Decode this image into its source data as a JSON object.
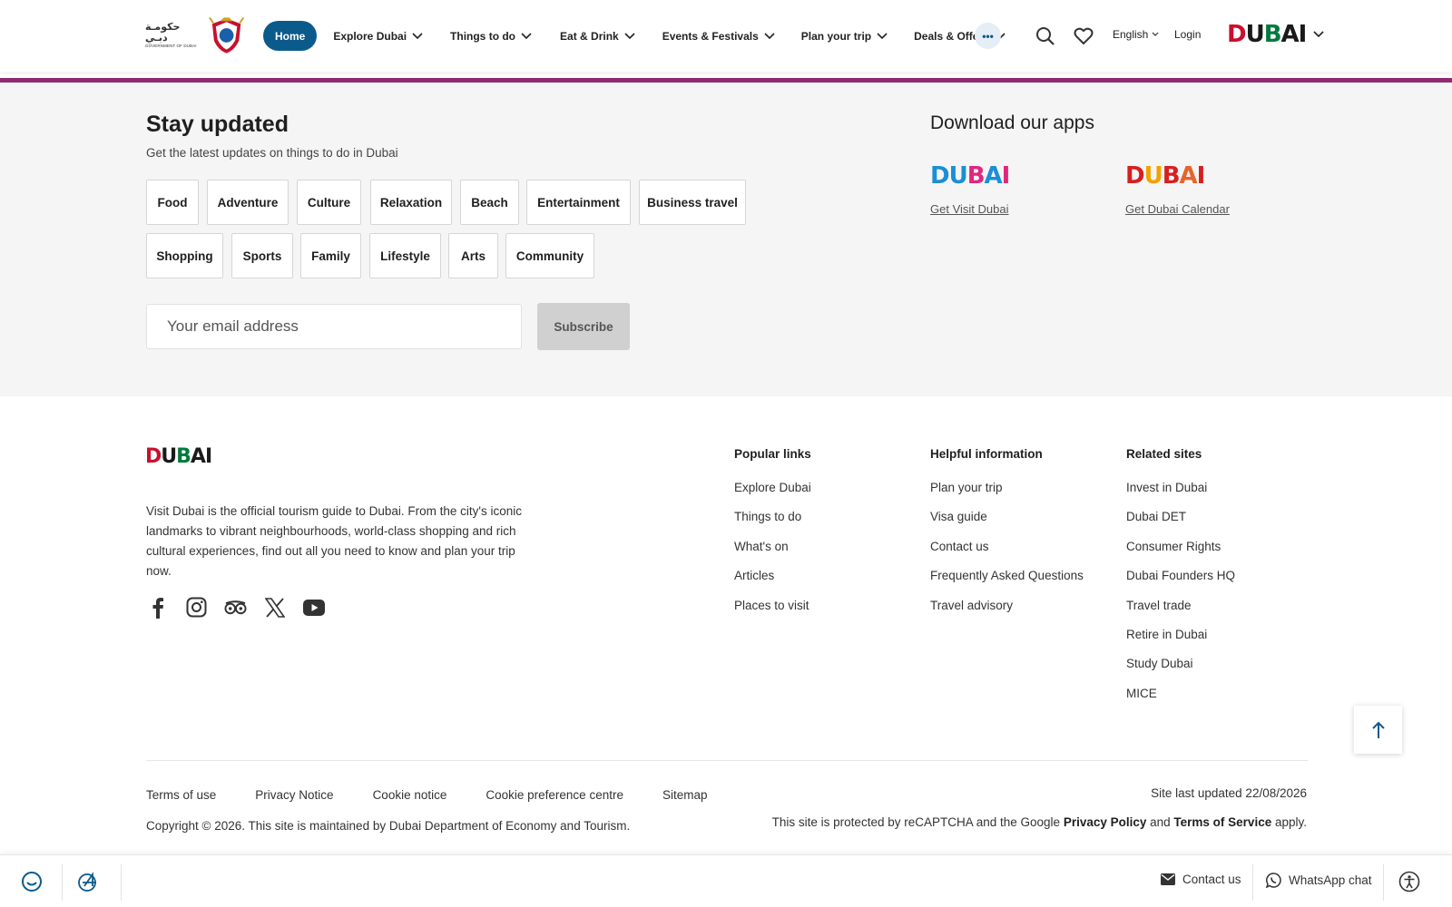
{
  "header": {
    "gov_logo_ar": "حكومـة دبـي",
    "gov_logo_en": "GOVERNMENT OF DUBAI",
    "home_label": "Home",
    "nav": [
      "Explore Dubai",
      "Things to do",
      "Eat & Drink",
      "Events & Festivals",
      "Plan your trip",
      "Deals & Offers"
    ],
    "more_label": "•••",
    "language": "English",
    "login": "Login",
    "brand_logo_text": "DUBAI"
  },
  "newsletter": {
    "title": "Stay updated",
    "subtitle": "Get the latest updates on things to do in Dubai",
    "interests_row1": [
      "Food",
      "Adventure",
      "Culture",
      "Relaxation",
      "Beach",
      "Entertainment",
      "Business travel"
    ],
    "interests_row2": [
      "Shopping",
      "Sports",
      "Family",
      "Lifestyle",
      "Arts",
      "Community"
    ],
    "email_placeholder": "Your email address",
    "subscribe_label": "Subscribe"
  },
  "apps": {
    "title": "Download our apps",
    "visit_dubai_link": "Get Visit Dubai",
    "calendar_link": "Get Dubai Calendar"
  },
  "footer": {
    "description": "Visit Dubai is the official tourism guide to Dubai. From the city's iconic landmarks to vibrant neighbourhoods, world-class shopping and rich cultural experiences, find out all you need to know and plan your trip now.",
    "popular_links": {
      "title": "Popular links",
      "items": [
        "Explore Dubai",
        "Things to do",
        "What's on",
        "Articles",
        "Places to visit"
      ]
    },
    "helpful_information": {
      "title": "Helpful information",
      "items": [
        "Plan your trip",
        "Visa guide",
        "Contact us",
        "Frequently Asked Questions",
        "Travel advisory"
      ]
    },
    "related_sites": {
      "title": "Related sites",
      "items": [
        "Invest in Dubai",
        "Dubai DET",
        "Consumer Rights",
        "Dubai Founders HQ",
        "Travel trade",
        "Retire in Dubai",
        "Study Dubai",
        "MICE"
      ]
    },
    "legal_links": [
      "Terms of use",
      "Privacy Notice",
      "Cookie notice",
      "Cookie preference centre",
      "Sitemap"
    ],
    "copyright": "Copyright © 2026. This site is maintained by Dubai Department of Economy and Tourism.",
    "site_updated": "Site last updated 22/08/2026",
    "recaptcha_prefix": "This site is protected by reCAPTCHA and the Google ",
    "privacy_policy": "Privacy Policy",
    "recaptcha_and": " and ",
    "terms_of_service": "Terms of Service",
    "recaptcha_suffix": " apply."
  },
  "bottom_bar": {
    "contact_us": "Contact us",
    "whatsapp": "WhatsApp chat"
  },
  "colors": {
    "primary_blue": "#0b5a8c",
    "purple_band": "#8e2a72",
    "newsletter_bg": "#f5f5f5",
    "subscribe_bg": "#d0d0d0"
  },
  "icons": {
    "header": [
      "chevron-down-icon",
      "search-icon",
      "heart-icon",
      "more-icon"
    ],
    "social": [
      "facebook-icon",
      "instagram-icon",
      "tripadvisor-icon",
      "x-icon",
      "youtube-icon"
    ],
    "bottom_bar": [
      "feedback-smile-icon",
      "accessibility-helper-icon",
      "mail-icon",
      "whatsapp-icon",
      "accessibility-icon"
    ],
    "back_to_top": "arrow-up-icon"
  }
}
